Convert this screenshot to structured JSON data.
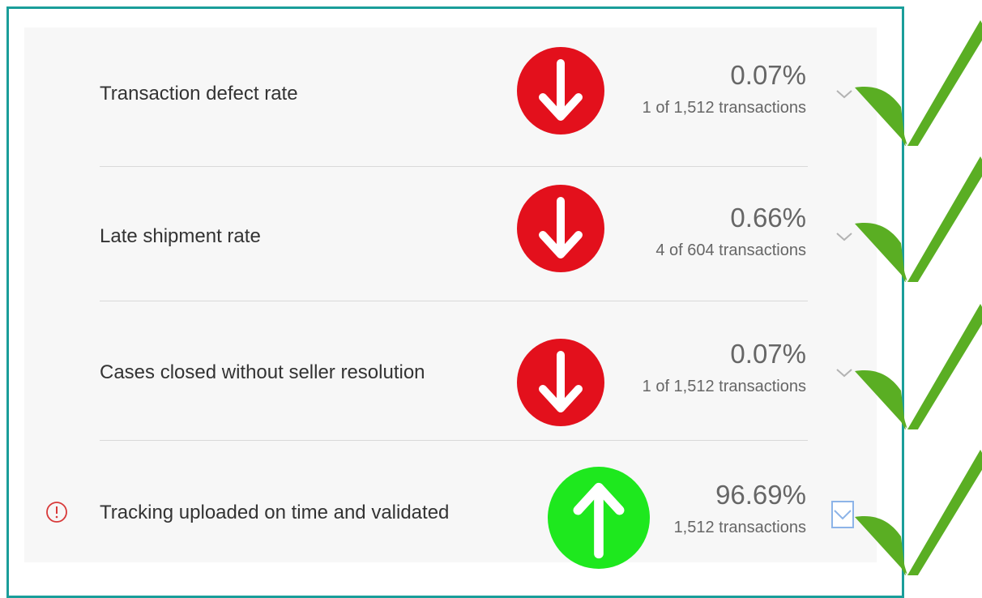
{
  "metrics": [
    {
      "label": "Transaction defect rate",
      "value": "0.07%",
      "detail": "1 of 1,512 transactions",
      "trend": "down",
      "warning": false
    },
    {
      "label": "Late shipment rate",
      "value": "0.66%",
      "detail": "4 of 604 transactions",
      "trend": "down",
      "warning": false
    },
    {
      "label": "Cases closed without seller resolution",
      "value": "0.07%",
      "detail": "1 of 1,512 transactions",
      "trend": "down",
      "warning": false
    },
    {
      "label": "Tracking uploaded on time and validated",
      "value": "96.69%",
      "detail": "1,512 transactions",
      "trend": "up",
      "warning": true
    }
  ],
  "icons": {
    "down_arrow": "arrow-down-icon",
    "up_arrow": "arrow-up-icon",
    "expand": "chevron-down-icon",
    "warning": "exclamation-circle-icon",
    "check": "checkmark-icon"
  },
  "colors": {
    "frame_border": "#1a9e9a",
    "panel_background": "#f7f7f7",
    "down_circle": "#e3101c",
    "up_circle": "#1ee81e",
    "check": "#5aae23",
    "warning": "#d83a3a",
    "text_primary": "#333333",
    "text_secondary": "#666666"
  }
}
